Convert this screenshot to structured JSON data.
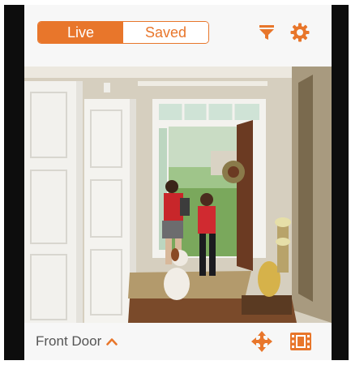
{
  "header": {
    "tabs": [
      {
        "label": "Live",
        "active": true
      },
      {
        "label": "Saved",
        "active": false
      }
    ],
    "filter_icon": "filter-icon",
    "settings_icon": "gear-icon"
  },
  "feed": {
    "description_icon": "camera-live-view"
  },
  "footer": {
    "camera_name": "Front Door",
    "expand_icon": "chevron-up-icon",
    "pan_tilt_icon": "pan-tilt-arrows-icon",
    "clips_icon": "film-strip-icon"
  },
  "colors": {
    "accent": "#e8762b",
    "bar_background": "#f7f7f7",
    "label_text": "#555555",
    "bezel": "#0d0d0d"
  }
}
